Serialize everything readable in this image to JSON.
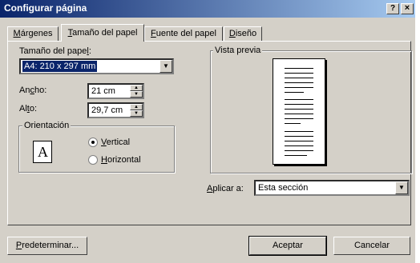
{
  "window": {
    "title": "Configurar página",
    "help": "?",
    "close": "×"
  },
  "tabs": [
    {
      "label": "Márgenes",
      "accel": "M",
      "rest": "árgenes"
    },
    {
      "label": "Tamaño del papel",
      "accel": "T",
      "rest": "amaño del papel"
    },
    {
      "label": "Fuente del papel",
      "accel": "F",
      "rest": "uente del papel"
    },
    {
      "label": "Diseño",
      "accel": "D",
      "rest": "iseño"
    }
  ],
  "paper_size": {
    "label_pre": "Tamaño del pape",
    "label_accel": "l",
    "label_post": ":",
    "value": "A4: 210 x 297 mm"
  },
  "width": {
    "label_pre": "An",
    "label_accel": "c",
    "label_post": "ho:",
    "value": "21 cm"
  },
  "height": {
    "label_pre": "Al",
    "label_accel": "t",
    "label_post": "o:",
    "value": "29,7 cm"
  },
  "orientation": {
    "title": "Orientación",
    "icon_letter": "A",
    "vertical": {
      "accel": "V",
      "rest": "ertical",
      "checked": true
    },
    "horizontal": {
      "accel": "H",
      "rest": "orizontal",
      "checked": false
    }
  },
  "preview": {
    "title": "Vista previa"
  },
  "apply_to": {
    "label_accel": "A",
    "label_rest": "plicar a:",
    "value": "Esta sección"
  },
  "buttons": {
    "default": {
      "accel": "P",
      "rest": "redeterminar..."
    },
    "ok": "Aceptar",
    "cancel": "Cancelar"
  }
}
